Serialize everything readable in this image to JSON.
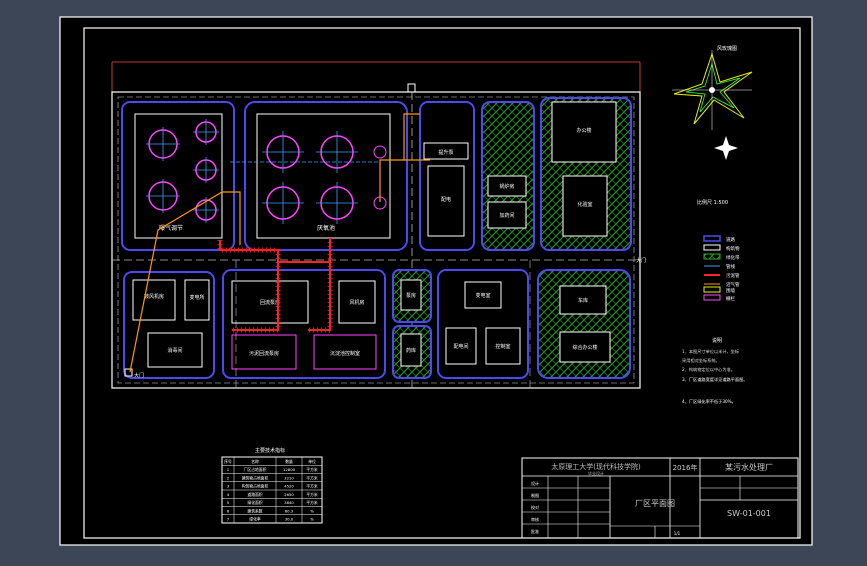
{
  "drawing": {
    "background": "#000000",
    "frame_color": "#ffffff",
    "road_color": "#4a4af0",
    "building_color": "#ffffff",
    "tank_color": "#ff44ff",
    "pipe_color": "#ff2020",
    "gas_pipe_color": "#ff9900",
    "green_color": "#2fa12f",
    "site_labels": {
      "tank_zone_left": "曝气调节",
      "tank_zone_right": "厌氧池",
      "pump_room": "提升泵",
      "control": "配电",
      "boiler": "锅炉房",
      "dosing": "加药间",
      "shed": "棚",
      "office": "办公楼",
      "lab": "化验室",
      "sludge_dewatering": "污泥脱水机房",
      "sludge_tank": "污泥浓缩池",
      "workshop_a": "维修间",
      "workshop_b": "仓库",
      "gate": "门卫",
      "left_block_a": "鼓风机房",
      "left_block_b": "变电所",
      "left_block_c": "消毒间",
      "mid_a": "回流泵房",
      "mid_b": "风机房",
      "mid_c": "污泥回流泵房",
      "mid_d": "沉淀池控制室",
      "small_a": "泵房",
      "small_b": "药库",
      "center_a": "变电室",
      "center_b": "配电间",
      "center_c": "控制室",
      "right_a": "车库",
      "right_b": "综合办公楼",
      "entrance": "大门",
      "road_tag": "大门"
    },
    "compass_label": "风玫瑰图",
    "scale_text": "比例尺  1:500",
    "legend": {
      "items": [
        "道路",
        "构筑物",
        "绿化带",
        "管线",
        "污泥管",
        "沼气管",
        "围墙",
        "栅栏"
      ]
    },
    "notes": {
      "title": "说明",
      "lines": [
        "1、本图尺寸单位以米计，坐标",
        "采用相对坐标系统。",
        "2、构筑物定位以中心为准。",
        "3、厂区道路宽度详见道路平面图。",
        "4、厂区绿化率不低于30%。"
      ]
    },
    "table": {
      "title": "主要技术指标",
      "headers": [
        "序号",
        "名称",
        "数量",
        "单位"
      ],
      "rows": [
        [
          "1",
          "厂区占地面积",
          "12800",
          "平方米"
        ],
        [
          "2",
          "建筑物占地面积",
          "3210",
          "平方米"
        ],
        [
          "3",
          "构筑物占地面积",
          "4520",
          "平方米"
        ],
        [
          "4",
          "道路面积",
          "2650",
          "平方米"
        ],
        [
          "5",
          "绿化面积",
          "3840",
          "平方米"
        ],
        [
          "6",
          "建筑系数",
          "60.3",
          "%"
        ],
        [
          "7",
          "绿化率",
          "30.0",
          "%"
        ]
      ]
    },
    "title_block": {
      "school": "太原理工大学(现代科技学院)",
      "school_sub": "毕业设计",
      "year": "2016年",
      "project": "某污水处理厂",
      "drawing_name": "厂区平面图",
      "drawing_no": "SW-01-001",
      "role_rows": [
        "设计",
        "制图",
        "校对",
        "审核",
        "批准"
      ],
      "sheet": "1/1"
    }
  }
}
